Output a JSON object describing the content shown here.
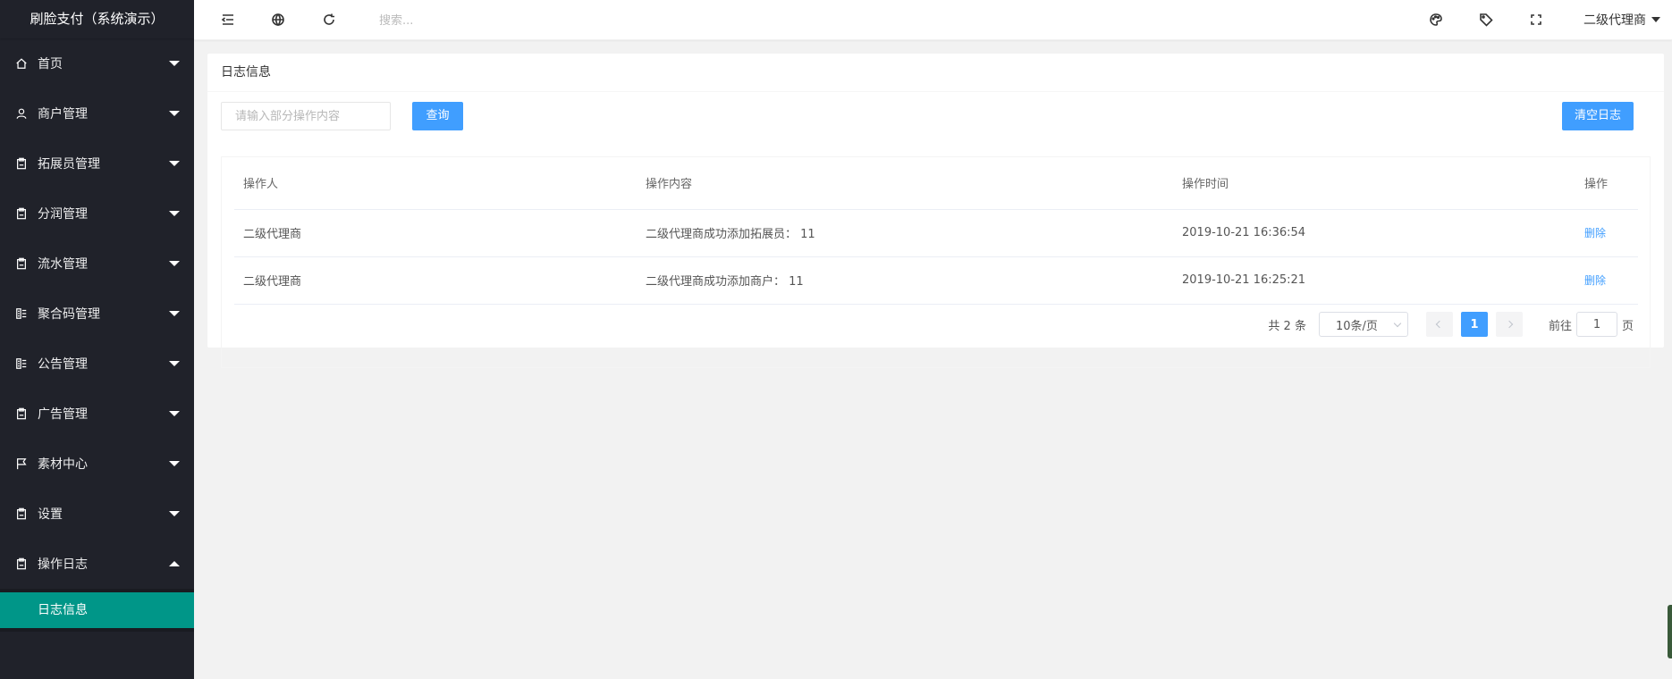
{
  "sidebar": {
    "logo": "刷脸支付（系统演示）",
    "items": [
      {
        "label": "首页",
        "icon": "home-icon",
        "open": false
      },
      {
        "label": "商户管理",
        "icon": "user-icon",
        "open": false
      },
      {
        "label": "拓展员管理",
        "icon": "clipboard-icon",
        "open": false
      },
      {
        "label": "分润管理",
        "icon": "clipboard-icon",
        "open": false
      },
      {
        "label": "流水管理",
        "icon": "clipboard-icon",
        "open": false
      },
      {
        "label": "聚合码管理",
        "icon": "list-icon",
        "open": false
      },
      {
        "label": "公告管理",
        "icon": "list-icon",
        "open": false
      },
      {
        "label": "广告管理",
        "icon": "clipboard-icon",
        "open": false
      },
      {
        "label": "素材中心",
        "icon": "flag-icon",
        "open": false
      },
      {
        "label": "设置",
        "icon": "clipboard-icon",
        "open": false
      },
      {
        "label": "操作日志",
        "icon": "clipboard-icon",
        "open": true
      }
    ],
    "submenu": {
      "label": "日志信息",
      "active_color": "#009688"
    }
  },
  "header": {
    "search_placeholder": "搜索...",
    "user": "二级代理商",
    "icons": [
      "menu-shrink-icon",
      "website-icon",
      "refresh-icon",
      "palette-icon",
      "tag-icon",
      "fullscreen-icon"
    ]
  },
  "card": {
    "title": "日志信息",
    "query_placeholder": "请输入部分操作内容",
    "query_button": "查询",
    "clear_button": "清空日志",
    "accent": "#409eff"
  },
  "table": {
    "headers": [
      "操作人",
      "操作内容",
      "操作时间",
      "操作"
    ],
    "rows": [
      {
        "user": "二级代理商",
        "content": "二级代理商成功添加拓展员： 11",
        "time": "2019-10-21 16:36:54",
        "action": "删除"
      },
      {
        "user": "二级代理商",
        "content": "二级代理商成功添加商户： 11",
        "time": "2019-10-21 16:25:21",
        "action": "删除"
      }
    ]
  },
  "pager": {
    "total": "共 2 条",
    "page_size": "10条/页",
    "current_page": "1",
    "goto_label": "前往",
    "goto_value": "1",
    "page_suffix": "页"
  }
}
